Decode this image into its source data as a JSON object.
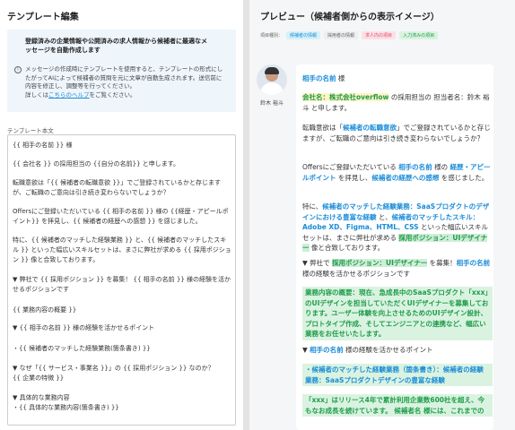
{
  "left": {
    "title": "テンプレート編集",
    "info_bold": "登録済みの企業情報や公開済みの求人情報から候補者に最適なメッセージを自動作成します",
    "info_icon": "i",
    "info_desc": "メッセージの作成時にテンプレートを使用すると、テンプレートの形式にしたがってAIによって候補者の質問を元に文章が自動生成されます。送信前に内容を修正し、調整等を行ってください。",
    "info_more_prefix": "詳しくは",
    "info_more_link": "こちらのヘルプ",
    "info_more_suffix": "をご覧ください。",
    "section_label": "テンプレート本文",
    "editor_lines": [
      "{{ 相手の名前 }} 様",
      "{{ 会社名 }} の採用担当の {{自分の名前}} と申します。",
      "転職意欲は「{{ 候補者の転職意欲 }}」でご登録されているかと存じますが、ご転職のご意向は引き続き変わらないでしょうか？",
      "Offersにご登録いただいている {{ 相手の名前 }} 様の {{経歴・アピールポイント}} を拝見し、{{ 候補者の経歴への感想 }} を感じました。",
      "特に、{{ 候補者のマッチした経験業務 }} と、{{ 候補者のマッチしたスキル }} といった幅広いスキルセットは、まさに弊社が求める {{ 採用ポジション }} 像と合致しております。",
      "▼ 弊社で {{ 採用ポジション }} を募集！ {{ 相手の名前 }} 様の経験を活かせるポジションです",
      "{{ 業務内容の概要 }}",
      "▼ {{ 相手の名前 }} 様の経験を活かせるポイント",
      "・{{ 候補者のマッチした経験業務(箇条書き) }}",
      "▼ なぜ「{{ サービス・事業名 }}」の {{ 採用ポジション }} なのか？",
      "{{ 企業の特徴 }}",
      "▼ 具体的な業務内容",
      "・{{ 具体的な業務内容(箇条書き) }}"
    ]
  },
  "right": {
    "title": "プレビュー（候補者側からの表示イメージ）",
    "legend_label": "項目種別：",
    "legend_items": [
      {
        "label": "候補者の情報",
        "bg": "#d6f1f9",
        "fg": "#1a8cd8"
      },
      {
        "label": "採用者の情報",
        "bg": "#f5f6f7",
        "fg": "#666666"
      },
      {
        "label": "求人内の項目",
        "bg": "#fde0e6",
        "fg": "#e04b6e"
      },
      {
        "label": "入力済みの項目",
        "bg": "#d9f3df",
        "fg": "#1f9c4a"
      }
    ],
    "author_name": "鈴木 裕斗",
    "msg": {
      "l1_name": "相手の名前",
      "l1_suffix": " 様",
      "l2_company": "会社名：株式会社overflow",
      "l2_rest": " の採用担当の 担当者名：鈴木 裕斗 と申します。",
      "l3_pre": "転職意欲は「",
      "l3_hl": "候補者の転職意欲",
      "l3_post": "」でご登録されているかと存じますが、ご転職のご意向は引き続き変わらないでしょうか？",
      "l4_pre": "Offersにご登録いただいている ",
      "l4_name": "相手の名前",
      "l4_mid": " 様の ",
      "l4_career": "経歴・アピールポイント",
      "l4_mid2": " を拝見し、",
      "l4_impr": "候補者の経歴への感想",
      "l4_post": " を感じました。",
      "l5_pre": "特に、",
      "l5_exp": "候補者のマッチした経験業務：SaaSプロダクトのデザインにおける豊富な経験",
      "l5_mid": " と、",
      "l5_skill": "候補者のマッチしたスキル：Adobe XD、Figma、HTML、CSS",
      "l5_mid2": " といった幅広いスキルセットは、まさに弊社が求める ",
      "l5_pos": "採用ポジション：UIデザイナー",
      "l5_post": " 像と合致しております。",
      "l6_pre": "▼ 弊社で ",
      "l6_pos": "採用ポジション：UIデザイナー",
      "l6_mid": " を募集！",
      "l6_name": "相手の名前",
      "l6_post": " 様の経験を活かせるポジションです",
      "l7_block": "業務内容の概要：現在、急成長中のSaaSプロダクト「xxx」のUIデザインを担当していただくUIデザイナーを募集しております。ユーザー体験を向上させるためのUIデザイン設計、プロトタイプ作成、そしてエンジニアとの連携など、幅広い業務をお任せいたします。",
      "l8_pre": "▼ ",
      "l8_name": "相手の名前",
      "l8_post": " 様の経験を活かせるポイント",
      "l9_block": "・候補者のマッチした経験業務（箇条書き）：候補者の経験業務：SaaSプロダクトデザインの豊富な経験",
      "l10_block": "「xxx」はリリース4年で累計利用企業数600社を超え、今もなお成長を続けています。 候補者名 様には、これまでの"
    }
  }
}
